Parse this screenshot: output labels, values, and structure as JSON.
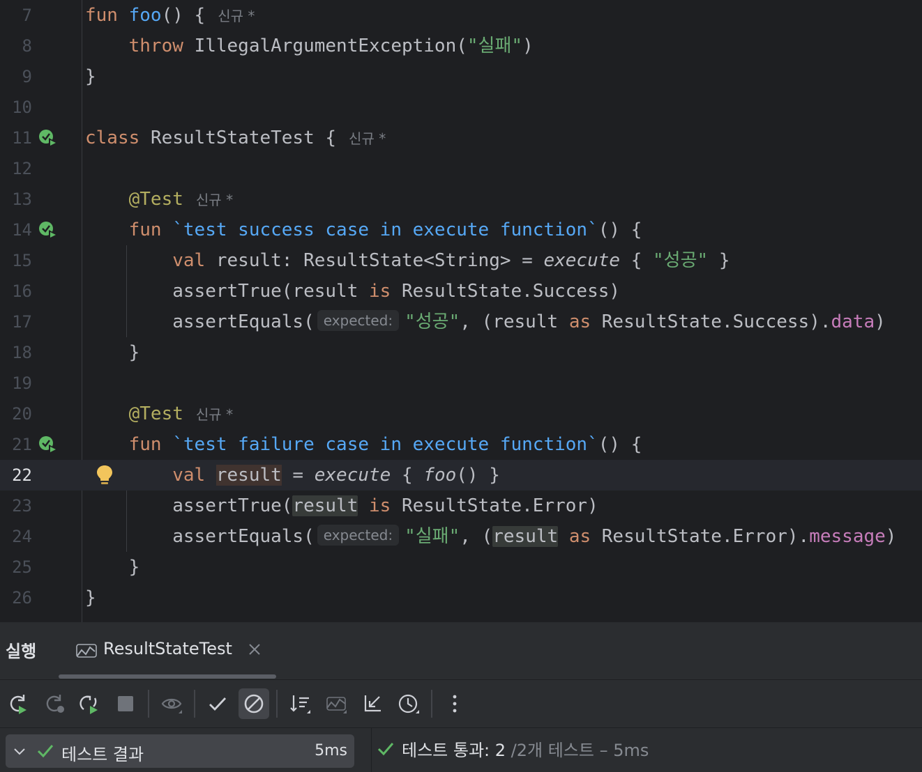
{
  "colors": {
    "editor_bg": "#1e1f22",
    "panel_bg": "#2b2d30",
    "keyword": "#cf8e6d",
    "function": "#56a8f5",
    "string": "#6aab73",
    "annotation": "#b3ae60",
    "property": "#c77dbb",
    "success": "#5fb865"
  },
  "editor": {
    "lines": [
      {
        "n": "7"
      },
      {
        "n": "8"
      },
      {
        "n": "9"
      },
      {
        "n": "10"
      },
      {
        "n": "11"
      },
      {
        "n": "12"
      },
      {
        "n": "13"
      },
      {
        "n": "14"
      },
      {
        "n": "15"
      },
      {
        "n": "16"
      },
      {
        "n": "17"
      },
      {
        "n": "18"
      },
      {
        "n": "19"
      },
      {
        "n": "20"
      },
      {
        "n": "21"
      },
      {
        "n": "22"
      },
      {
        "n": "23"
      },
      {
        "n": "24"
      },
      {
        "n": "25"
      },
      {
        "n": "26"
      }
    ],
    "current_line": "22",
    "code": {
      "l7_kw": "fun",
      "l7_name": "foo",
      "l7_rest": "() {",
      "l8_kw": "throw",
      "l8_rest": "IllegalArgumentException(",
      "l8_str": "\"실패\"",
      "l8_end": ")",
      "l9": "}",
      "l11_kw": "class",
      "l11_rest": "ResultStateTest {",
      "l13_ann": "@Test",
      "l14_kw": "fun",
      "l14_name": "`test success case in execute function`",
      "l14_rest": "() {",
      "l15_kw": "val",
      "l15_a": "result: ResultState<String> = ",
      "l15_it": "execute",
      "l15_b": " { ",
      "l15_str": "\"성공\"",
      "l15_c": " }",
      "l16_a": "assertTrue(result ",
      "l16_kw": "is",
      "l16_b": " ResultState.Success)",
      "l17_a": "assertEquals(",
      "l17_hint": "expected:",
      "l17_str": "\"성공\"",
      "l17_b": ", (result ",
      "l17_kw": "as",
      "l17_c": " ResultState.Success).",
      "l17_prop": "data",
      "l17_d": ")",
      "l18": "}",
      "l20_ann": "@Test",
      "l21_kw": "fun",
      "l21_name": "`test failure case in execute function`",
      "l21_rest": "() {",
      "l22_kw": "val",
      "l22_var": "result",
      "l22_a": " = ",
      "l22_it": "execute",
      "l22_b": " { ",
      "l22_it2": "foo",
      "l22_c": "() }",
      "l23_a": "assertTrue(",
      "l23_var": "result",
      "l23_kw": "is",
      "l23_b": " ResultState.Error)",
      "l24_a": "assertEquals(",
      "l24_hint": "expected:",
      "l24_str": "\"실패\"",
      "l24_b": ", (",
      "l24_var": "result",
      "l24_kw": "as",
      "l24_c": " ResultState.Error).",
      "l24_prop": "message",
      "l24_d": ")",
      "l25": "}",
      "l26": "}"
    },
    "lens_label": "신규 *",
    "gutter_icons": [
      "run-test-passed-icon",
      "lightbulb-icon"
    ]
  },
  "run_panel": {
    "title": "실행",
    "tab_label": "ResultStateTest",
    "toolbar_icons": [
      "rerun-icon",
      "rerun-failed-icon",
      "toggle-auto-test-icon",
      "stop-icon",
      "eye-icon",
      "check-icon",
      "cancel-icon",
      "sort-icon",
      "diff-icon",
      "collapse-icon",
      "history-icon",
      "more-icon"
    ],
    "tree": {
      "label": "테스트 결과",
      "time": "5ms"
    },
    "status": {
      "main": "테스트 통과: 2",
      "sub": "/2개 테스트 – 5ms"
    }
  }
}
